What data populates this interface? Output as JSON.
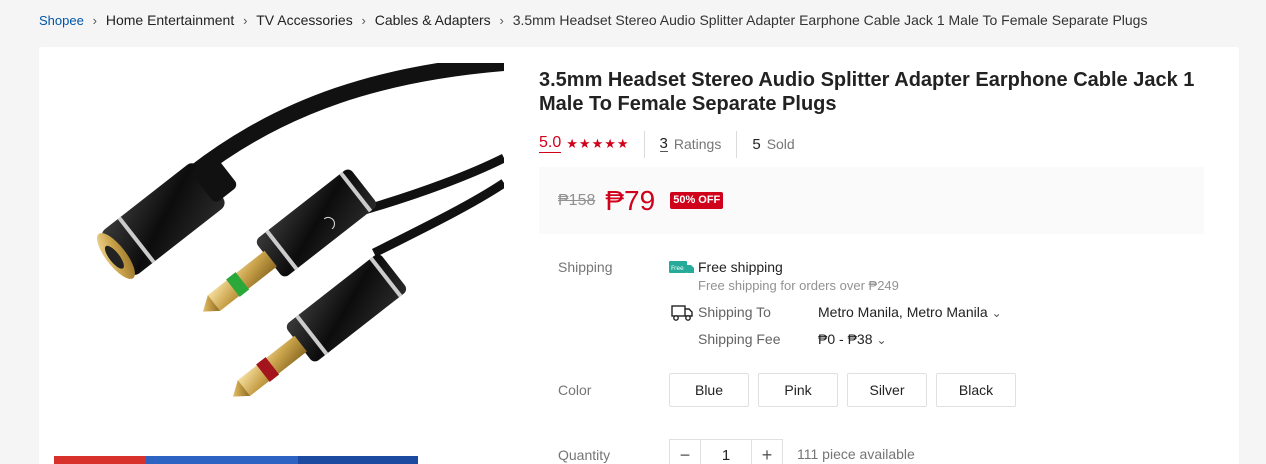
{
  "breadcrumb": {
    "items": [
      "Shopee",
      "Home Entertainment",
      "TV Accessories",
      "Cables & Adapters",
      "3.5mm Headset Stereo Audio Splitter Adapter Earphone Cable Jack 1 Male To Female Separate Plugs"
    ],
    "separator_icon": "chevron-right-icon"
  },
  "product": {
    "title": "3.5mm Headset Stereo Audio Splitter Adapter Earphone Cable Jack 1 Male To Female Separate Plugs",
    "rating": {
      "score": "5.0",
      "stars": 5
    },
    "ratings_count": "3",
    "ratings_label": "Ratings",
    "sold_count": "5",
    "sold_label": "Sold",
    "price": {
      "original": "₱158",
      "current": "₱79",
      "discount": "50% OFF"
    },
    "image_thumb_colors": [
      "#d8312b",
      "#2d64c4",
      "#1c4aa0"
    ]
  },
  "shipping": {
    "label": "Shipping",
    "free_title": "Free shipping",
    "free_note": "Free shipping for orders over ₱249",
    "to_label": "Shipping To",
    "to_value": "Metro Manila, Metro Manila",
    "fee_label": "Shipping Fee",
    "fee_value": "₱0 - ₱38",
    "free_badge_text": "Free"
  },
  "color": {
    "label": "Color",
    "options": [
      "Blue",
      "Pink",
      "Silver",
      "Black"
    ]
  },
  "quantity": {
    "label": "Quantity",
    "value": "1",
    "minus": "−",
    "plus": "+",
    "available": "111 piece available"
  },
  "colors": {
    "accent": "#d0011b",
    "link": "#0055aa",
    "free_ship": "#26aa99"
  }
}
